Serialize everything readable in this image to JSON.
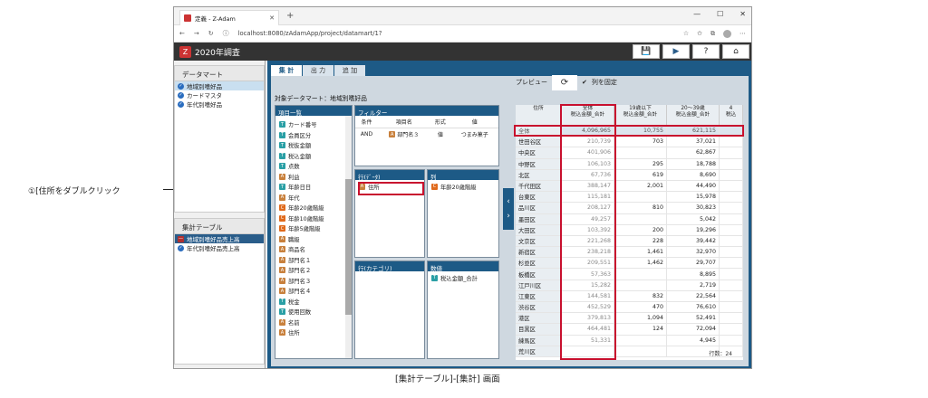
{
  "browser": {
    "tab_title": "定義 - Z-Adam",
    "url": "localhost:8080/zAdamApp/project/datamart/1?",
    "new_tab": "+",
    "minimize": "—",
    "maximize": "☐",
    "close": "✕"
  },
  "app": {
    "title": "2020年調査",
    "save_icon": "💾",
    "run_icon": "▶",
    "help_icon": "?",
    "home_icon": "⌂"
  },
  "left": {
    "datamart_header": "データマート",
    "datamart_items": [
      "地域別嗜好品",
      "カードマスタ",
      "年代別嗜好品"
    ],
    "table_header": "集計テーブル",
    "table_items": [
      "地域別嗜好品売上高",
      "年代別嗜好品売上高"
    ]
  },
  "tabs": [
    "集 計",
    "出 力",
    "追 加"
  ],
  "target_label": "対象データマート：地域別嗜好品",
  "fields": {
    "header": "項目一覧",
    "items": [
      {
        "icon": "T",
        "type": "t",
        "label": "カード番号"
      },
      {
        "icon": "T",
        "type": "t",
        "label": "会員区分"
      },
      {
        "icon": "T",
        "type": "t",
        "label": "税抜金額"
      },
      {
        "icon": "T",
        "type": "t",
        "label": "税込金額"
      },
      {
        "icon": "T",
        "type": "t",
        "label": "点数"
      },
      {
        "icon": "A",
        "type": "a",
        "label": "利益"
      },
      {
        "icon": "T",
        "type": "t",
        "label": "年齢日日"
      },
      {
        "icon": "A",
        "type": "a",
        "label": "年代"
      },
      {
        "icon": "C",
        "type": "c",
        "label": "年齢20歳階級"
      },
      {
        "icon": "C",
        "type": "c",
        "label": "年齢10歳階級"
      },
      {
        "icon": "C",
        "type": "c",
        "label": "年齢5歳階級"
      },
      {
        "icon": "A",
        "type": "a",
        "label": "職級"
      },
      {
        "icon": "A",
        "type": "a",
        "label": "商品名"
      },
      {
        "icon": "A",
        "type": "a",
        "label": "部門名１"
      },
      {
        "icon": "A",
        "type": "a",
        "label": "部門名２"
      },
      {
        "icon": "A",
        "type": "a",
        "label": "部門名３"
      },
      {
        "icon": "A",
        "type": "a",
        "label": "部門名４"
      },
      {
        "icon": "T",
        "type": "t",
        "label": "税金"
      },
      {
        "icon": "T",
        "type": "t",
        "label": "使用回数"
      },
      {
        "icon": "A",
        "type": "a",
        "label": "名前"
      },
      {
        "icon": "A",
        "type": "a",
        "label": "住所"
      }
    ]
  },
  "filter": {
    "header": "フィルター",
    "columns": [
      "条件",
      "項目名",
      "形式",
      "値"
    ],
    "row": {
      "cond": "AND",
      "field": "部門名３",
      "format": "値",
      "value": "つまみ菓子"
    }
  },
  "rows_box": {
    "header": "行(ﾃﾞｰﾀ)",
    "item": "住所"
  },
  "cols_box": {
    "header": "列",
    "item": "年齢20歳階級"
  },
  "rowcat_box": {
    "header": "行(カテゴリ)"
  },
  "values_box": {
    "header": "数値",
    "item": "税込金額_合計"
  },
  "preview": {
    "label": "プレビュー",
    "refresh_icon": "⟳",
    "fix_col_label": "列を固定",
    "headers": [
      {
        "l1": "住所",
        "l2": ""
      },
      {
        "l1": "全体",
        "l2": "税込金額_合計"
      },
      {
        "l1": "19歳以下",
        "l2": "税込金額_合計"
      },
      {
        "l1": "20～39歳",
        "l2": "税込金額_合計"
      },
      {
        "l1": "4",
        "l2": "税込"
      }
    ],
    "rows": [
      [
        "全体",
        "4,096,965",
        "10,755",
        "621,115",
        ""
      ],
      [
        "世田谷区",
        "210,739",
        "703",
        "37,021",
        ""
      ],
      [
        "中央区",
        "401,906",
        "",
        "62,867",
        ""
      ],
      [
        "中野区",
        "106,103",
        "295",
        "18,788",
        ""
      ],
      [
        "北区",
        "67,736",
        "619",
        "8,690",
        ""
      ],
      [
        "千代田区",
        "388,147",
        "2,001",
        "44,490",
        ""
      ],
      [
        "台東区",
        "115,181",
        "",
        "15,978",
        ""
      ],
      [
        "品川区",
        "208,127",
        "810",
        "30,823",
        ""
      ],
      [
        "墨田区",
        "49,257",
        "",
        "5,042",
        ""
      ],
      [
        "大田区",
        "103,392",
        "200",
        "19,296",
        ""
      ],
      [
        "文京区",
        "221,268",
        "228",
        "39,442",
        ""
      ],
      [
        "新宿区",
        "238,218",
        "1,461",
        "32,970",
        ""
      ],
      [
        "杉並区",
        "209,551",
        "1,462",
        "29,707",
        ""
      ],
      [
        "板橋区",
        "57,363",
        "",
        "8,895",
        ""
      ],
      [
        "江戸川区",
        "15,282",
        "",
        "2,719",
        ""
      ],
      [
        "江東区",
        "144,581",
        "832",
        "22,564",
        ""
      ],
      [
        "渋谷区",
        "452,529",
        "470",
        "76,610",
        ""
      ],
      [
        "港区",
        "379,813",
        "1,094",
        "52,491",
        ""
      ],
      [
        "目黒区",
        "464,481",
        "124",
        "72,094",
        ""
      ],
      [
        "練馬区",
        "51,331",
        "",
        "4,945",
        ""
      ],
      [
        "荒川区",
        "",
        "",
        "",
        ""
      ]
    ],
    "row_count": "行数：24"
  },
  "annotation": "①[住所をダブルクリック",
  "caption": "[集計テーブル]-[集計] 画面"
}
